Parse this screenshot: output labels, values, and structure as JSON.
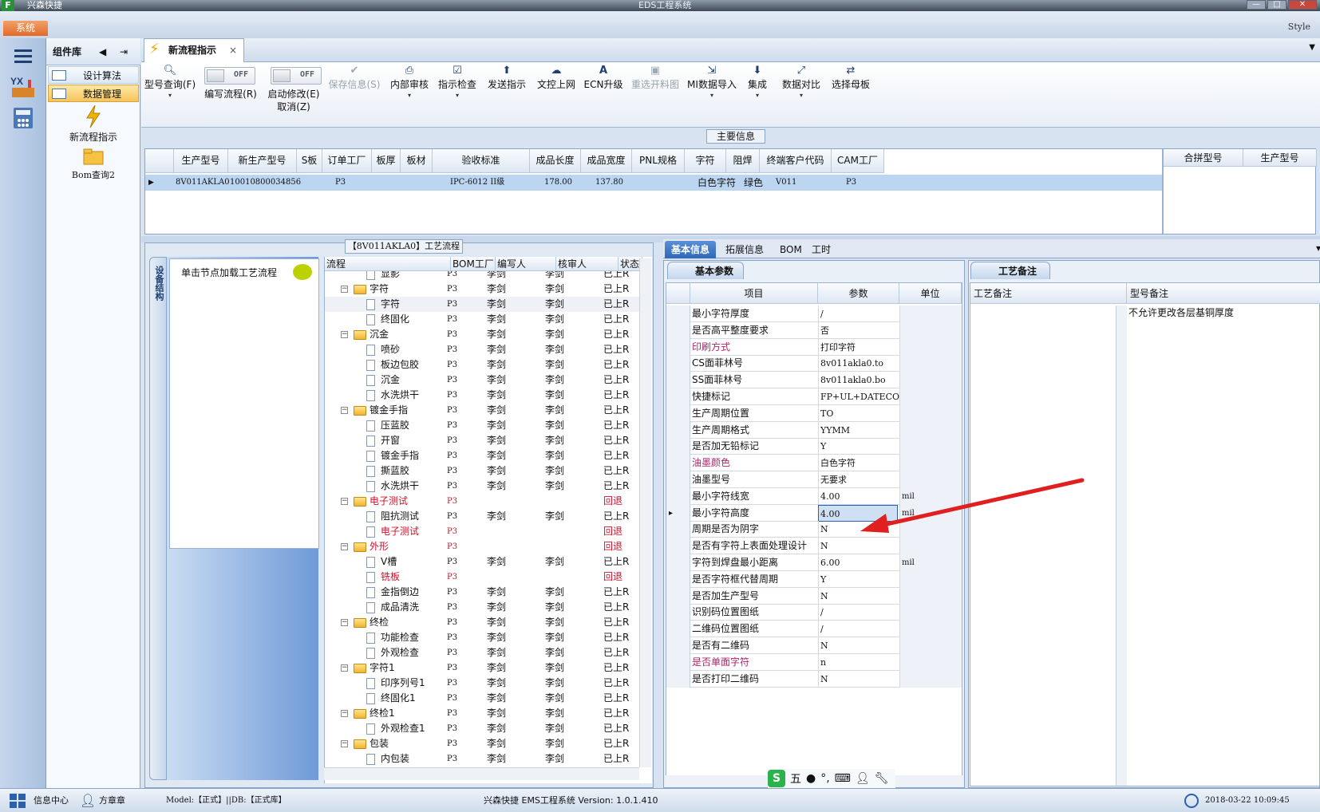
{
  "titlebar": {
    "logo": "F",
    "app": "兴森快捷",
    "title": "EDS工程系统",
    "controls": [
      "—",
      "□",
      "✕"
    ]
  },
  "menu": {
    "system": "系统",
    "style": "Style"
  },
  "component_panel": {
    "title": "组件库",
    "items": [
      {
        "label": "设计算法"
      },
      {
        "label": "数据管理"
      }
    ],
    "tools": [
      {
        "label": "新流程指示"
      },
      {
        "label": "Bom查询2"
      }
    ]
  },
  "doc_tab": {
    "label": "新流程指示",
    "close": "×"
  },
  "toolbar": {
    "items": [
      {
        "label": "型号查询(F)",
        "icon": "search-icon",
        "dd": "▾"
      },
      {
        "label": "编写流程(R)",
        "toggle": "OFF"
      },
      {
        "label": "启动修改(E)",
        "label2": "取消(Z)",
        "toggle": "OFF"
      },
      {
        "label": "保存信息(S)",
        "icon": "check-icon",
        "disabled": true
      },
      {
        "label": "内部审核",
        "icon": "print-icon",
        "dd": "▾"
      },
      {
        "label": "指示检查",
        "icon": "checkbox-icon",
        "dd": "▾"
      },
      {
        "label": "发送指示",
        "icon": "upload-icon"
      },
      {
        "label": "文控上网",
        "icon": "cloud-icon"
      },
      {
        "label": "ECN升级",
        "icon": "ecn-icon"
      },
      {
        "label": "重选开料图",
        "icon": "image-icon",
        "disabled": true
      },
      {
        "label": "MI数据导入",
        "icon": "import-icon",
        "dd": "▾"
      },
      {
        "label": "集成",
        "icon": "download-icon",
        "dd": "▾"
      },
      {
        "label": "数据对比",
        "icon": "compare-icon",
        "dd": "▾"
      },
      {
        "label": "选择母板",
        "icon": "shuffle-icon"
      }
    ]
  },
  "main_info": {
    "label": "主要信息",
    "headers": [
      "生产型号",
      "新生产型号",
      "S板",
      "订单工厂",
      "板厚",
      "板材",
      "验收标准",
      "成品长度",
      "成品宽度",
      "PNL规格",
      "字符",
      "阻焊",
      "终端客户代码",
      "CAM工厂"
    ],
    "row": [
      "8V011AKLA0",
      "10010800034856",
      "",
      "P3",
      "",
      "",
      "IPC-6012 II级",
      "178.00",
      "137.80",
      "",
      "白色字符",
      "绿色",
      "V011",
      "P3"
    ],
    "right_headers": [
      "合拼型号",
      "生产型号"
    ]
  },
  "process": {
    "label": "【8V011AKLA0】工艺流程",
    "vtab": "设备结构",
    "load_hint": "单击节点加载工艺流程",
    "headers": [
      "流程",
      "BOM工厂",
      "编写人",
      "核审人",
      "状态"
    ],
    "rows": [
      {
        "name": "显影",
        "level": 2,
        "factory": "P3",
        "writer": "李剑",
        "reviewer": "李剑",
        "status": "已上R"
      },
      {
        "name": "字符",
        "level": 1,
        "factory": "P3",
        "writer": "李剑",
        "reviewer": "李剑",
        "status": "已上R"
      },
      {
        "name": "字符",
        "level": 2,
        "factory": "P3",
        "writer": "李剑",
        "reviewer": "李剑",
        "status": "已上R",
        "selected": true
      },
      {
        "name": "终固化",
        "level": 2,
        "factory": "P3",
        "writer": "李剑",
        "reviewer": "李剑",
        "status": "已上R"
      },
      {
        "name": "沉金",
        "level": 1,
        "factory": "P3",
        "writer": "李剑",
        "reviewer": "李剑",
        "status": "已上R"
      },
      {
        "name": "喷砂",
        "level": 2,
        "factory": "P3",
        "writer": "李剑",
        "reviewer": "李剑",
        "status": "已上R"
      },
      {
        "name": "板边包胶",
        "level": 2,
        "factory": "P3",
        "writer": "李剑",
        "reviewer": "李剑",
        "status": "已上R"
      },
      {
        "name": "沉金",
        "level": 2,
        "factory": "P3",
        "writer": "李剑",
        "reviewer": "李剑",
        "status": "已上R"
      },
      {
        "name": "水洗烘干",
        "level": 2,
        "factory": "P3",
        "writer": "李剑",
        "reviewer": "李剑",
        "status": "已上R"
      },
      {
        "name": "镀金手指",
        "level": 1,
        "factory": "P3",
        "writer": "李剑",
        "reviewer": "李剑",
        "status": "已上R"
      },
      {
        "name": "压蓝胶",
        "level": 2,
        "factory": "P3",
        "writer": "李剑",
        "reviewer": "李剑",
        "status": "已上R"
      },
      {
        "name": "开窗",
        "level": 2,
        "factory": "P3",
        "writer": "李剑",
        "reviewer": "李剑",
        "status": "已上R"
      },
      {
        "name": "镀金手指",
        "level": 2,
        "factory": "P3",
        "writer": "李剑",
        "reviewer": "李剑",
        "status": "已上R"
      },
      {
        "name": "撕蓝胶",
        "level": 2,
        "factory": "P3",
        "writer": "李剑",
        "reviewer": "李剑",
        "status": "已上R"
      },
      {
        "name": "水洗烘干",
        "level": 2,
        "factory": "P3",
        "writer": "李剑",
        "reviewer": "李剑",
        "status": "已上R"
      },
      {
        "name": "电子测试",
        "level": 1,
        "factory": "P3",
        "writer": "",
        "reviewer": "",
        "status": "回退",
        "red": true
      },
      {
        "name": "阻抗测试",
        "level": 2,
        "factory": "P3",
        "writer": "李剑",
        "reviewer": "李剑",
        "status": "已上R"
      },
      {
        "name": "电子测试",
        "level": 2,
        "factory": "P3",
        "writer": "",
        "reviewer": "",
        "status": "回退",
        "red": true
      },
      {
        "name": "外形",
        "level": 1,
        "factory": "P3",
        "writer": "",
        "reviewer": "",
        "status": "回退",
        "red": true
      },
      {
        "name": "V槽",
        "level": 2,
        "factory": "P3",
        "writer": "李剑",
        "reviewer": "李剑",
        "status": "已上R"
      },
      {
        "name": "铣板",
        "level": 2,
        "factory": "P3",
        "writer": "",
        "reviewer": "",
        "status": "回退",
        "red": true
      },
      {
        "name": "金指倒边",
        "level": 2,
        "factory": "P3",
        "writer": "李剑",
        "reviewer": "李剑",
        "status": "已上R"
      },
      {
        "name": "成品清洗",
        "level": 2,
        "factory": "P3",
        "writer": "李剑",
        "reviewer": "李剑",
        "status": "已上R"
      },
      {
        "name": "终检",
        "level": 1,
        "factory": "P3",
        "writer": "李剑",
        "reviewer": "李剑",
        "status": "已上R"
      },
      {
        "name": "功能检查",
        "level": 2,
        "factory": "P3",
        "writer": "李剑",
        "reviewer": "李剑",
        "status": "已上R"
      },
      {
        "name": "外观检查",
        "level": 2,
        "factory": "P3",
        "writer": "李剑",
        "reviewer": "李剑",
        "status": "已上R"
      },
      {
        "name": "字符1",
        "level": 1,
        "factory": "P3",
        "writer": "李剑",
        "reviewer": "李剑",
        "status": "已上R"
      },
      {
        "name": "印序列号1",
        "level": 2,
        "factory": "P3",
        "writer": "李剑",
        "reviewer": "李剑",
        "status": "已上R"
      },
      {
        "name": "终固化1",
        "level": 2,
        "factory": "P3",
        "writer": "李剑",
        "reviewer": "李剑",
        "status": "已上R"
      },
      {
        "name": "终检1",
        "level": 1,
        "factory": "P3",
        "writer": "李剑",
        "reviewer": "李剑",
        "status": "已上R"
      },
      {
        "name": "外观检查1",
        "level": 2,
        "factory": "P3",
        "writer": "李剑",
        "reviewer": "李剑",
        "status": "已上R"
      },
      {
        "name": "包装",
        "level": 1,
        "factory": "P3",
        "writer": "李剑",
        "reviewer": "李剑",
        "status": "已上R"
      },
      {
        "name": "内包装",
        "level": 2,
        "factory": "P3",
        "writer": "李剑",
        "reviewer": "李剑",
        "status": "已上R"
      }
    ]
  },
  "right_tabs": [
    "基本信息",
    "拓展信息",
    "BOM",
    "工时"
  ],
  "basic_params": {
    "tab": "基本参数",
    "headers": [
      "项目",
      "参数",
      "单位"
    ],
    "rows": [
      {
        "name": "最小字符厚度",
        "value": "/",
        "unit": ""
      },
      {
        "name": "是否高平整度要求",
        "value": "否",
        "unit": ""
      },
      {
        "name": "印刷方式",
        "value": "打印字符",
        "unit": "",
        "pink": true
      },
      {
        "name": "CS面菲林号",
        "value": "8v011akla0.to",
        "unit": ""
      },
      {
        "name": "SS面菲林号",
        "value": "8v011akla0.bo",
        "unit": ""
      },
      {
        "name": "快捷标记",
        "value": "FP+UL+DATECODE",
        "unit": ""
      },
      {
        "name": "生产周期位置",
        "value": "TO",
        "unit": ""
      },
      {
        "name": "生产周期格式",
        "value": "YYMM",
        "unit": ""
      },
      {
        "name": "是否加无铅标记",
        "value": "Y",
        "unit": ""
      },
      {
        "name": "油墨颜色",
        "value": "白色字符",
        "unit": "",
        "pink": true
      },
      {
        "name": "油墨型号",
        "value": "无要求",
        "unit": ""
      },
      {
        "name": "最小字符线宽",
        "value": "4.00",
        "unit": "mil"
      },
      {
        "name": "最小字符高度",
        "value": "4.00",
        "unit": "mil",
        "selected": true
      },
      {
        "name": "周期是否为阴字",
        "value": "N",
        "unit": ""
      },
      {
        "name": "是否有字符上表面处理设计",
        "value": "N",
        "unit": ""
      },
      {
        "name": "字符到焊盘最小距离",
        "value": "6.00",
        "unit": "mil"
      },
      {
        "name": "是否字符框代替周期",
        "value": "Y",
        "unit": ""
      },
      {
        "name": "是否加生产型号",
        "value": "N",
        "unit": ""
      },
      {
        "name": "识别码位置图纸",
        "value": "/",
        "unit": ""
      },
      {
        "name": "二维码位置图纸",
        "value": "/",
        "unit": ""
      },
      {
        "name": "是否有二维码",
        "value": "N",
        "unit": ""
      },
      {
        "name": "是否单面字符",
        "value": "n",
        "unit": "",
        "pink": true
      },
      {
        "name": "是否打印二维码",
        "value": "N",
        "unit": ""
      }
    ]
  },
  "notes": {
    "tab": "工艺备注",
    "headers": [
      "工艺备注",
      "型号备注"
    ],
    "model_note": "不允许更改各层基铜厚度"
  },
  "ime": {
    "wu": "五"
  },
  "statusbar": {
    "info": "信息中心",
    "user": "方章章",
    "model": "Model:【正式】||DB:【正式库】",
    "system": "兴森快捷 EMS工程系统 Version: 1.0.1.410",
    "datetime": "2018-03-22 10:09:45"
  },
  "colors": {
    "accent": "#2f68b8",
    "selected_row": "#bcd6f2",
    "red": "#d0102a",
    "pink": "#b0246e",
    "arrow": "#e02020"
  }
}
